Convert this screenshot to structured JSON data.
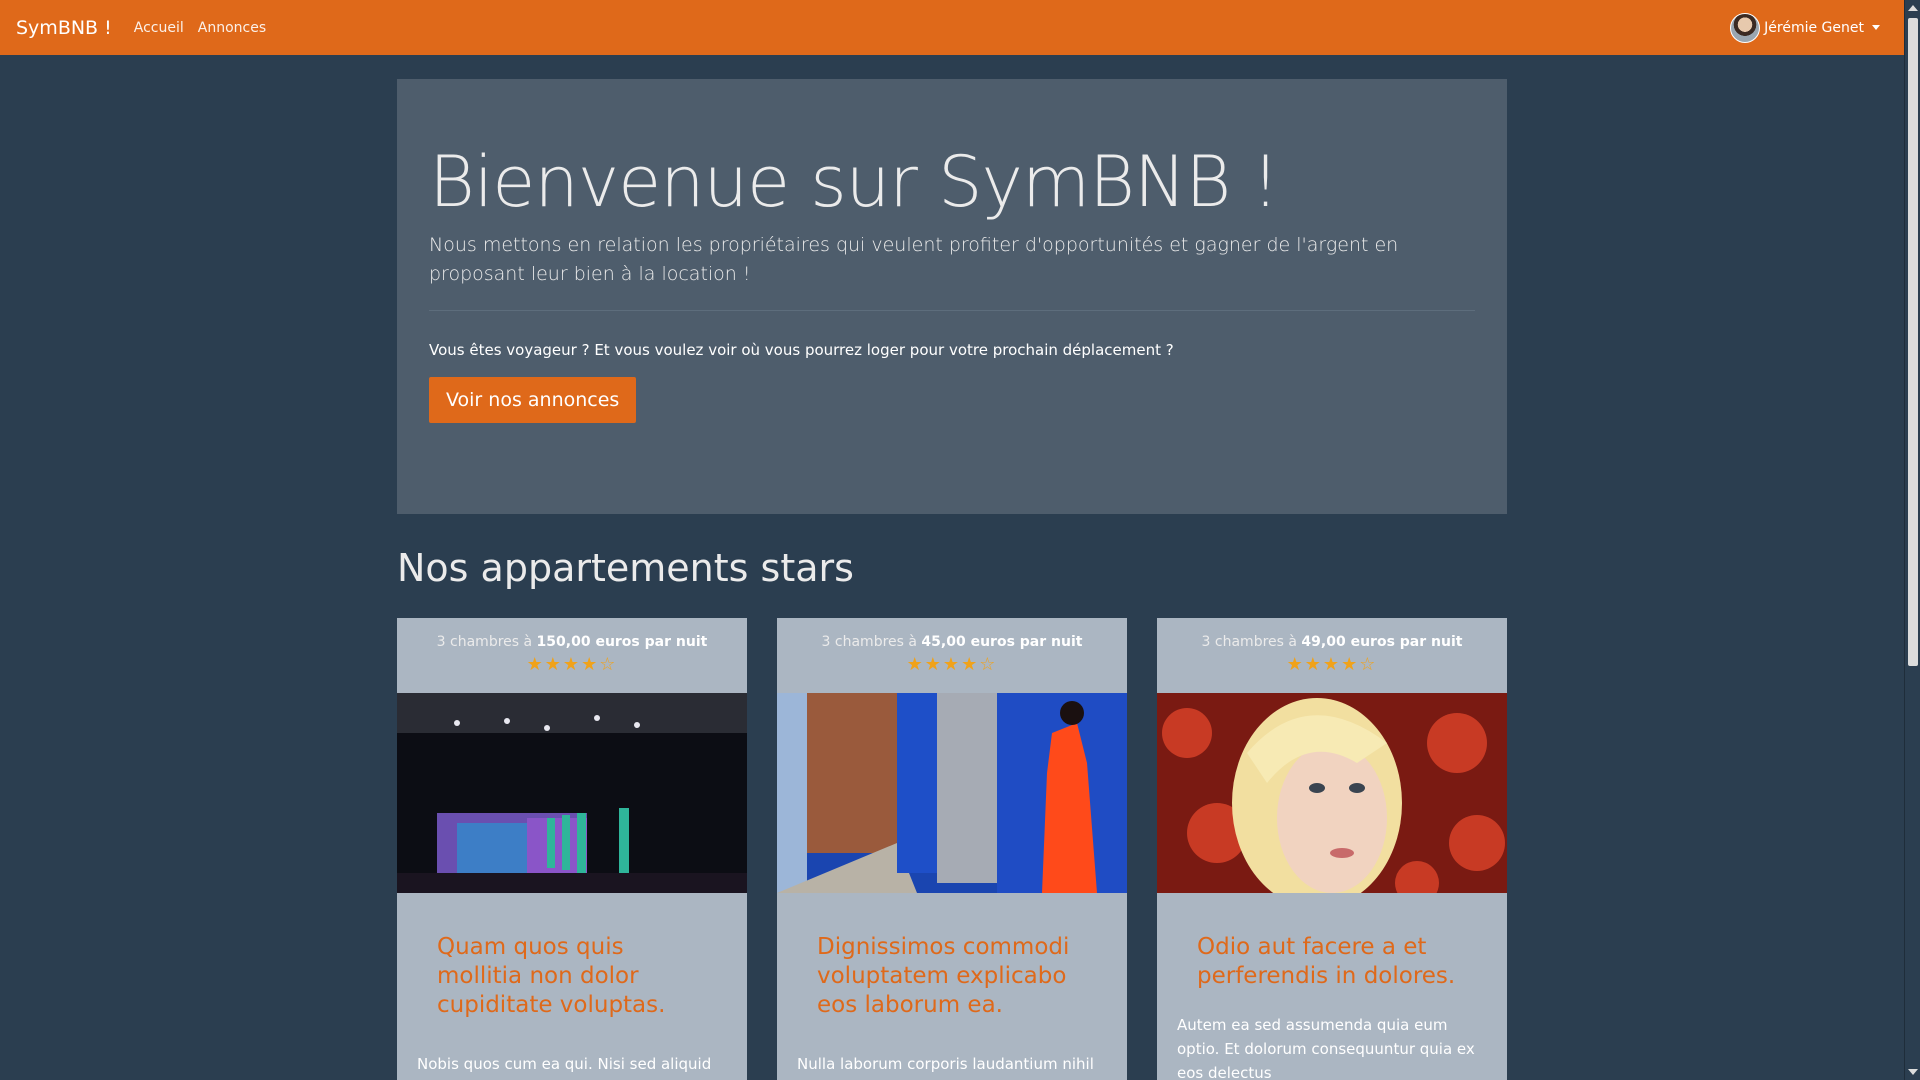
{
  "navbar": {
    "brand": "SymBNB !",
    "links": [
      "Accueil",
      "Annonces"
    ],
    "user": "Jérémie Genet"
  },
  "jumbotron": {
    "title": "Bienvenue sur SymBNB !",
    "lead": "Nous mettons en relation les propriétaires qui veulent profiter d'opportunités et gagner de l'argent en proposant leur bien à la location !",
    "text": "Vous êtes voyageur ? Et vous voulez voir où vous pourrez loger pour votre prochain déplacement ?",
    "button": "Voir nos annonces"
  },
  "section_title": "Nos appartements stars",
  "cards": [
    {
      "rooms_text": "3 chambres à ",
      "price": "150,00 euros par nuit",
      "rating": 4,
      "rating_max": 5,
      "stars": "★★★★☆",
      "title": "Quam quos quis mollitia non dolor cupiditate voluptas.",
      "text": "Nobis quos cum ea qui. Nisi sed aliquid sed"
    },
    {
      "rooms_text": "3 chambres à ",
      "price": "45,00 euros par nuit",
      "rating": 4,
      "rating_max": 5,
      "stars": "★★★★☆",
      "title": "Dignissimos commodi voluptatem explicabo eos laborum ea.",
      "text": "Nulla laborum corporis laudantium nihil"
    },
    {
      "rooms_text": "3 chambres à ",
      "price": "49,00 euros par nuit",
      "rating": 4,
      "rating_max": 5,
      "stars": "★★★★☆",
      "title": "Odio aut facere a et perferendis in dolores.",
      "text": "Autem ea sed assumenda quia eum optio. Et dolorum consequuntur quia ex eos delectus"
    }
  ],
  "colors": {
    "primary": "#df691a",
    "background": "#2b3e50",
    "jumbotron": "#4e5d6c",
    "card": "#abb6c2",
    "star": "#f0a21a"
  }
}
